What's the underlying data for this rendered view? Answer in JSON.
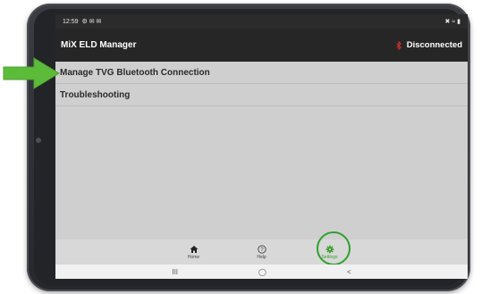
{
  "statusbar": {
    "time": "12:59",
    "left_icons": "⚙ ✉ ✉",
    "right_icons": "✖ ≈ ▮"
  },
  "appbar": {
    "title": "MiX ELD Manager",
    "connection_status": "Disconnected"
  },
  "list": {
    "items": [
      {
        "label": "Manage TVG Bluetooth Connection"
      },
      {
        "label": "Troubleshooting"
      }
    ]
  },
  "bottom_nav": {
    "items": [
      {
        "label": "Home",
        "icon": "home-icon"
      },
      {
        "label": "Help",
        "icon": "help-icon"
      },
      {
        "label": "Settings",
        "icon": "gear-icon",
        "active": true
      }
    ]
  },
  "system_nav": {
    "recents": "III",
    "home": "◯",
    "back": "<"
  },
  "colors": {
    "accent": "#3b9c2a",
    "arrow": "#5dbb3a",
    "disconnected": "#d32f2f",
    "appbar": "#262626"
  }
}
